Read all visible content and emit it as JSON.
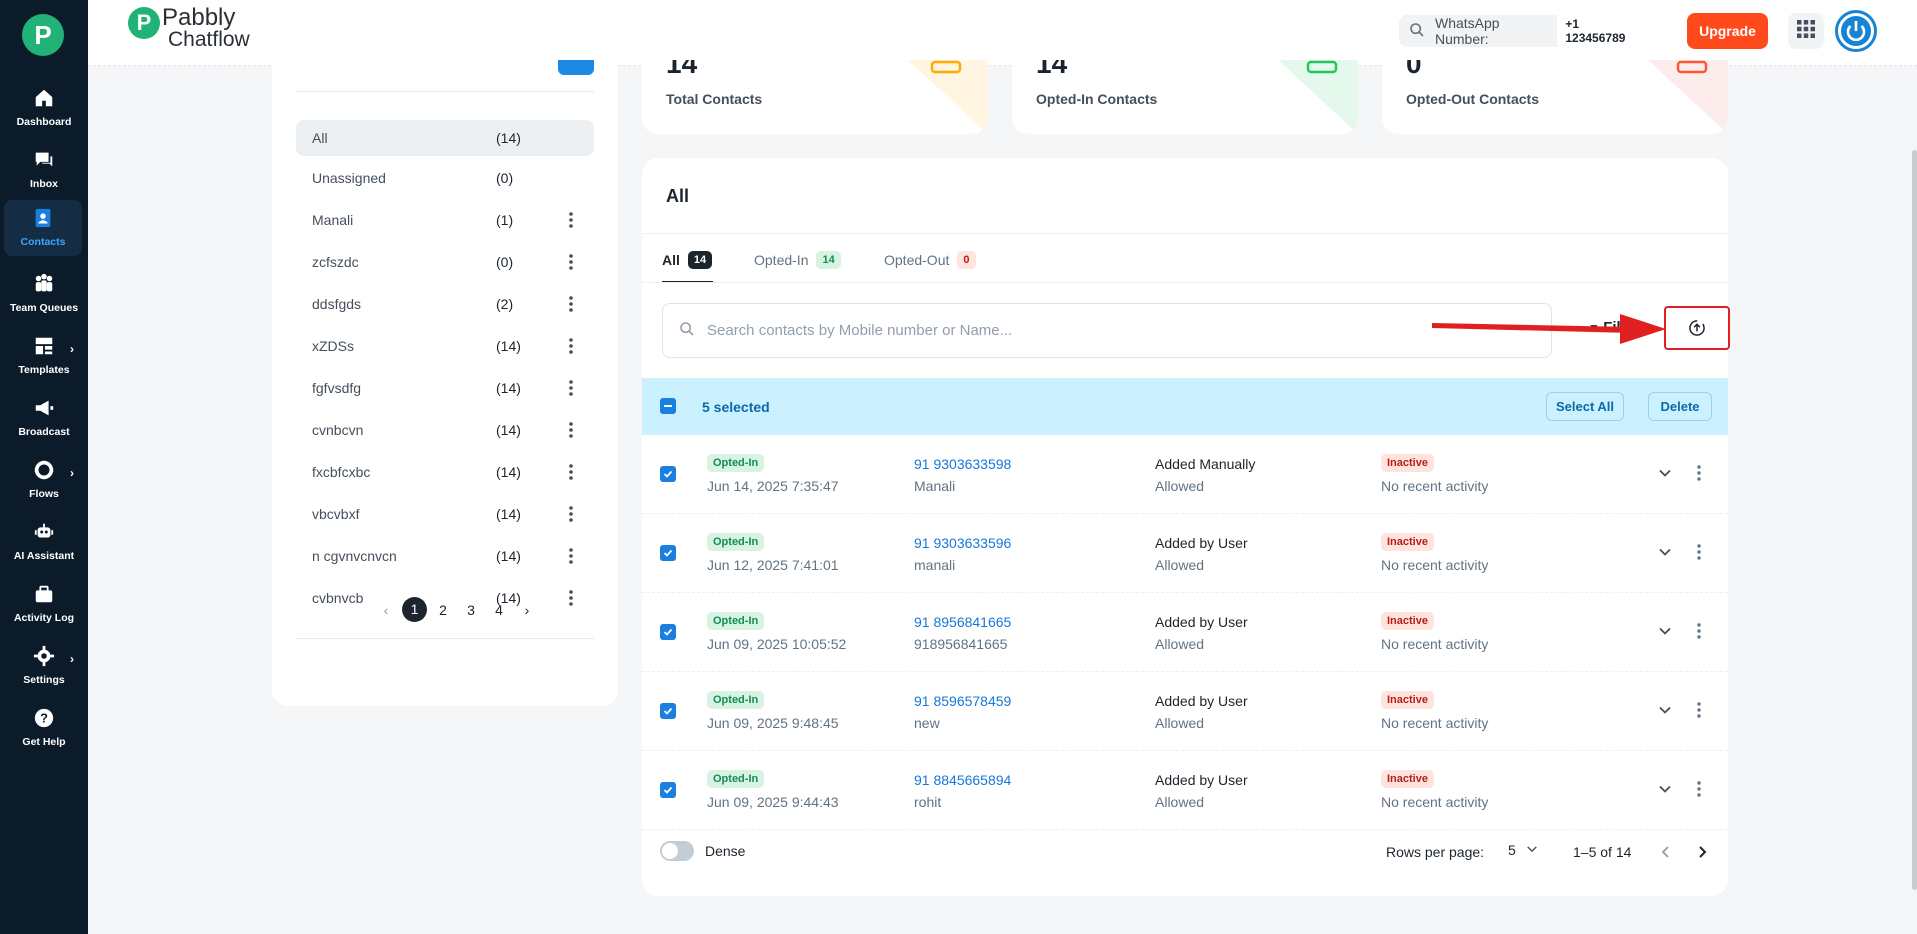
{
  "sidebar": {
    "logo_letter": "P",
    "items": [
      {
        "label": "Dashboard",
        "icon": "home-icon"
      },
      {
        "label": "Inbox",
        "icon": "chat-icon"
      },
      {
        "label": "Contacts",
        "icon": "contacts-icon",
        "active": true
      },
      {
        "label": "Team Queues",
        "icon": "team-icon"
      },
      {
        "label": "Templates",
        "icon": "templates-icon"
      },
      {
        "label": "Broadcast",
        "icon": "megaphone-icon"
      },
      {
        "label": "Flows",
        "icon": "flows-icon"
      },
      {
        "label": "AI Assistant",
        "icon": "robot-icon"
      },
      {
        "label": "Activity Log",
        "icon": "briefcase-icon"
      },
      {
        "label": "Settings",
        "icon": "gear-icon"
      },
      {
        "label": "Get Help",
        "icon": "help-icon"
      }
    ]
  },
  "header": {
    "brand_line1": "Pabbly",
    "brand_line2": "Chatflow",
    "brand_letter": "P",
    "wa_label": "WhatsApp Number:",
    "wa_number": "+1 123456789",
    "upgrade_label": "Upgrade"
  },
  "lists": {
    "rows": [
      {
        "name": "All",
        "count": "(14)"
      },
      {
        "name": "Unassigned",
        "count": "(0)"
      },
      {
        "name": "Manali",
        "count": "(1)"
      },
      {
        "name": "zcfszdc",
        "count": "(0)"
      },
      {
        "name": "ddsfgds",
        "count": "(2)"
      },
      {
        "name": "xZDSs",
        "count": "(14)"
      },
      {
        "name": "fgfvsdfg",
        "count": "(14)"
      },
      {
        "name": "cvnbcvn",
        "count": "(14)"
      },
      {
        "name": "fxcbfcxbc",
        "count": "(14)"
      },
      {
        "name": "vbcvbxf",
        "count": "(14)"
      },
      {
        "name": "n cgvnvcnvcn",
        "count": "(14)"
      },
      {
        "name": "cvbnvcb",
        "count": "(14)"
      }
    ],
    "pages": [
      "1",
      "2",
      "3",
      "4"
    ],
    "current_page": "1"
  },
  "stats": [
    {
      "value": "14",
      "label": "Total Contacts",
      "color": "#ffab00"
    },
    {
      "value": "14",
      "label": "Opted-In Contacts",
      "color": "#22c55e"
    },
    {
      "value": "0",
      "label": "Opted-Out Contacts",
      "color": "#ff5630"
    }
  ],
  "main": {
    "title": "All",
    "tabs": [
      {
        "label": "All",
        "count": "14"
      },
      {
        "label": "Opted-In",
        "count": "14"
      },
      {
        "label": "Opted-Out",
        "count": "0"
      }
    ],
    "search_placeholder": "Search contacts by Mobile number or Name...",
    "filters_label": "Filters",
    "selected_text": "5 selected",
    "select_all_label": "Select All",
    "delete_label": "Delete",
    "rows": [
      {
        "status": "Opted-In",
        "date": "Jun 14, 2025 7:35:47",
        "phone": "91 9303633598",
        "name": "Manali",
        "source": "Added Manually",
        "permission": "Allowed",
        "state": "Inactive",
        "activity": "No recent activity"
      },
      {
        "status": "Opted-In",
        "date": "Jun 12, 2025 7:41:01",
        "phone": "91 9303633596",
        "name": "manali",
        "source": "Added by User",
        "permission": "Allowed",
        "state": "Inactive",
        "activity": "No recent activity"
      },
      {
        "status": "Opted-In",
        "date": "Jun 09, 2025 10:05:52",
        "phone": "91 8956841665",
        "name": "918956841665",
        "source": "Added by User",
        "permission": "Allowed",
        "state": "Inactive",
        "activity": "No recent activity"
      },
      {
        "status": "Opted-In",
        "date": "Jun 09, 2025 9:48:45",
        "phone": "91 8596578459",
        "name": "new",
        "source": "Added by User",
        "permission": "Allowed",
        "state": "Inactive",
        "activity": "No recent activity"
      },
      {
        "status": "Opted-In",
        "date": "Jun 09, 2025 9:44:43",
        "phone": "91 8845665894",
        "name": "rohit",
        "source": "Added by User",
        "permission": "Allowed",
        "state": "Inactive",
        "activity": "No recent activity"
      }
    ],
    "footer": {
      "dense_label": "Dense",
      "rows_per_page_label": "Rows per page:",
      "rows_per_page_value": "5",
      "range": "1–5 of 14"
    }
  },
  "colors": {
    "sidebar_bg": "#0c1b2a",
    "accent": "#1a7fe0",
    "upgrade": "#ff4a1c",
    "annotation": "#e02020"
  }
}
